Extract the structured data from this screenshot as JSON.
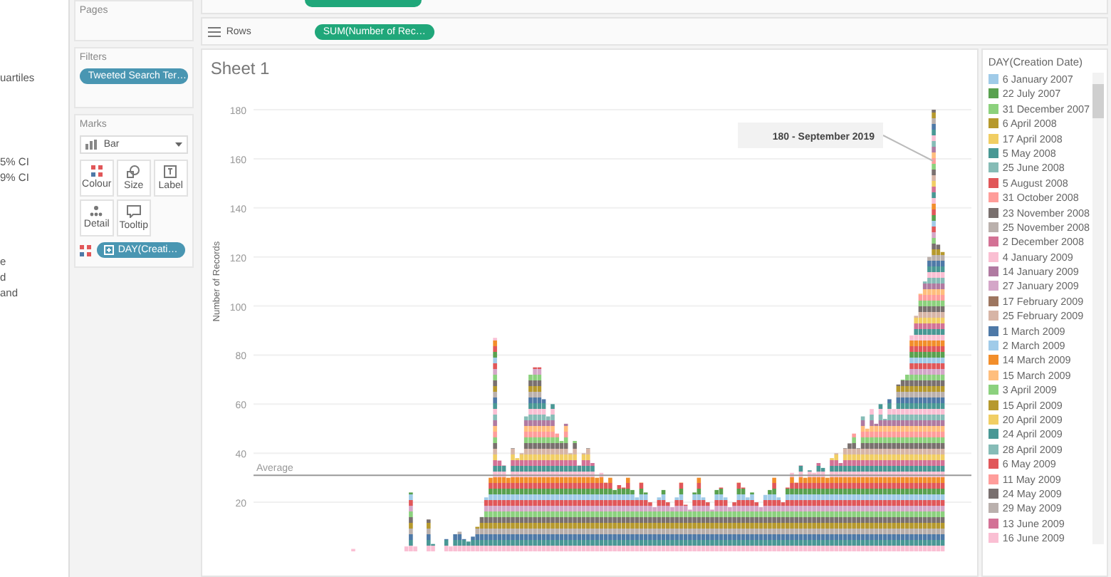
{
  "left_panel": {
    "groups": [
      [
        "uartiles"
      ],
      [
        "5% CI",
        "9% CI"
      ],
      [
        "e",
        "d",
        "and"
      ]
    ]
  },
  "shelves": {
    "rows": {
      "label": "Rows",
      "pill": "SUM(Number of Rec…"
    }
  },
  "pages_card": {
    "title": "Pages"
  },
  "filters_card": {
    "title": "Filters",
    "pills": [
      "Tweeted Search Ter…"
    ]
  },
  "marks_card": {
    "title": "Marks",
    "mark_type": "Bar",
    "buttons": [
      {
        "kind": "colour",
        "label": "Colour"
      },
      {
        "kind": "size",
        "label": "Size"
      },
      {
        "kind": "label",
        "label": "Label"
      },
      {
        "kind": "detail",
        "label": "Detail"
      },
      {
        "kind": "tooltip",
        "label": "Tooltip"
      }
    ],
    "fields": [
      {
        "kind": "colour",
        "label": "DAY(Creati…"
      }
    ]
  },
  "sheet": {
    "title": "Sheet 1",
    "chart_data": {
      "type": "bar",
      "ylabel": "Number of Records",
      "stacked": true,
      "ylim": [
        0,
        180
      ],
      "yticks": [
        20,
        40,
        60,
        80,
        100,
        120,
        140,
        160,
        180
      ],
      "values": [
        0,
        0,
        0,
        0,
        0,
        0,
        0,
        0,
        0,
        0,
        0,
        0,
        0,
        0,
        0,
        0,
        0,
        0,
        0,
        0,
        0,
        0,
        1,
        0,
        0,
        0,
        0,
        0,
        0,
        0,
        0,
        0,
        0,
        0,
        2,
        24,
        2,
        0,
        0,
        13,
        3,
        0,
        0,
        5,
        2,
        7,
        8,
        5,
        4,
        6,
        10,
        14,
        22,
        30,
        87,
        37,
        35,
        30,
        42,
        38,
        40,
        55,
        72,
        75,
        75,
        62,
        55,
        60,
        48,
        45,
        52,
        40,
        45,
        35,
        40,
        42,
        36,
        30,
        32,
        28,
        30,
        25,
        27,
        26,
        30,
        25,
        22,
        28,
        24,
        20,
        18,
        22,
        25,
        20,
        18,
        22,
        28,
        19,
        17,
        24,
        30,
        22,
        20,
        17,
        25,
        26,
        22,
        18,
        20,
        28,
        26,
        22,
        24,
        20,
        18,
        23,
        25,
        30,
        22,
        20,
        26,
        32,
        28,
        35,
        30,
        33,
        32,
        36,
        34,
        30,
        38,
        40,
        36,
        42,
        44,
        48,
        42,
        55,
        50,
        58,
        52,
        60,
        54,
        62,
        58,
        68,
        70,
        72,
        88,
        96,
        105,
        110,
        120,
        180,
        125,
        122,
        null,
        null,
        null,
        null,
        null,
        null
      ],
      "grid": true,
      "annotations": [
        {
          "text": "180 - September 2019"
        }
      ],
      "ref_lines": [
        {
          "axis": "y",
          "value": 31,
          "label": "Average"
        }
      ]
    }
  },
  "legend": {
    "title": "DAY(Creation Date)",
    "items": [
      {
        "label": "6 January 2007",
        "color": "#a0cbe8"
      },
      {
        "label": "22 July 2007",
        "color": "#59a14f"
      },
      {
        "label": "31 December 2007",
        "color": "#8cd17d"
      },
      {
        "label": "6 April 2008",
        "color": "#b6992d"
      },
      {
        "label": "17 April 2008",
        "color": "#f1ce63"
      },
      {
        "label": "5 May 2008",
        "color": "#499894"
      },
      {
        "label": "25 June 2008",
        "color": "#86bcb6"
      },
      {
        "label": "5 August 2008",
        "color": "#e15759"
      },
      {
        "label": "31 October 2008",
        "color": "#ff9d9a"
      },
      {
        "label": "23 November 2008",
        "color": "#79706e"
      },
      {
        "label": "25 November 2008",
        "color": "#bab0ac"
      },
      {
        "label": "2 December 2008",
        "color": "#d37295"
      },
      {
        "label": "4 January 2009",
        "color": "#fabfd2"
      },
      {
        "label": "14 January 2009",
        "color": "#b07aa1"
      },
      {
        "label": "27 January 2009",
        "color": "#d4a6c8"
      },
      {
        "label": "17 February 2009",
        "color": "#9d7660"
      },
      {
        "label": "25 February 2009",
        "color": "#d7b5a6"
      },
      {
        "label": "1 March 2009",
        "color": "#4e79a7"
      },
      {
        "label": "2 March 2009",
        "color": "#a0cbe9"
      },
      {
        "label": "14 March 2009",
        "color": "#f28e2b"
      },
      {
        "label": "15 March 2009",
        "color": "#ffbe7d"
      },
      {
        "label": "3 April 2009",
        "color": "#8cd17e"
      },
      {
        "label": "15 April 2009",
        "color": "#b6992e"
      },
      {
        "label": "20 April 2009",
        "color": "#f1ce64"
      },
      {
        "label": "24 April 2009",
        "color": "#499895"
      },
      {
        "label": "28 April 2009",
        "color": "#86bcb7"
      },
      {
        "label": "6 May 2009",
        "color": "#e1575a"
      },
      {
        "label": "11 May 2009",
        "color": "#ff9d9b"
      },
      {
        "label": "24 May 2009",
        "color": "#79706f"
      },
      {
        "label": "29 May 2009",
        "color": "#bab0ad"
      },
      {
        "label": "13 June 2009",
        "color": "#d37296"
      },
      {
        "label": "16 June 2009",
        "color": "#fabfd3"
      }
    ]
  }
}
